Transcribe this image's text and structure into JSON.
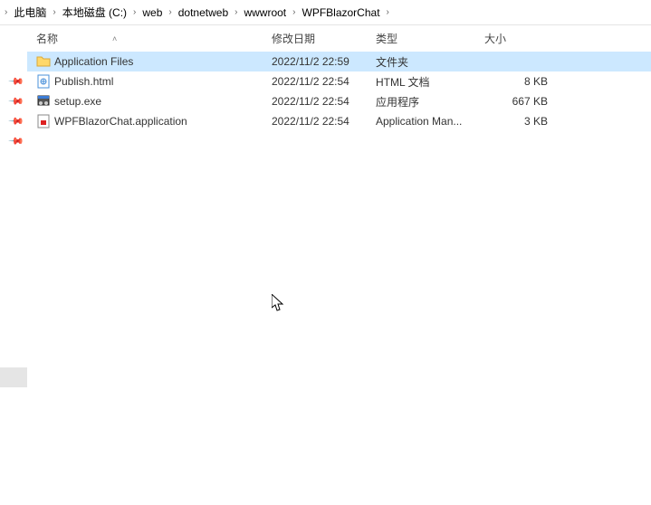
{
  "breadcrumb": [
    "此电脑",
    "本地磁盘 (C:)",
    "web",
    "dotnetweb",
    "wwwroot",
    "WPFBlazorChat"
  ],
  "columns": {
    "name": "名称",
    "date": "修改日期",
    "type": "类型",
    "size": "大小"
  },
  "rows": [
    {
      "icon": "folder",
      "name": "Application Files",
      "date": "2022/11/2 22:59",
      "type": "文件夹",
      "size": "",
      "selected": true
    },
    {
      "icon": "html",
      "name": "Publish.html",
      "date": "2022/11/2 22:54",
      "type": "HTML 文档",
      "size": "8 KB",
      "selected": false
    },
    {
      "icon": "exe",
      "name": "setup.exe",
      "date": "2022/11/2 22:54",
      "type": "应用程序",
      "size": "667 KB",
      "selected": false
    },
    {
      "icon": "app",
      "name": "WPFBlazorChat.application",
      "date": "2022/11/2 22:54",
      "type": "Application Man...",
      "size": "3 KB",
      "selected": false
    }
  ]
}
